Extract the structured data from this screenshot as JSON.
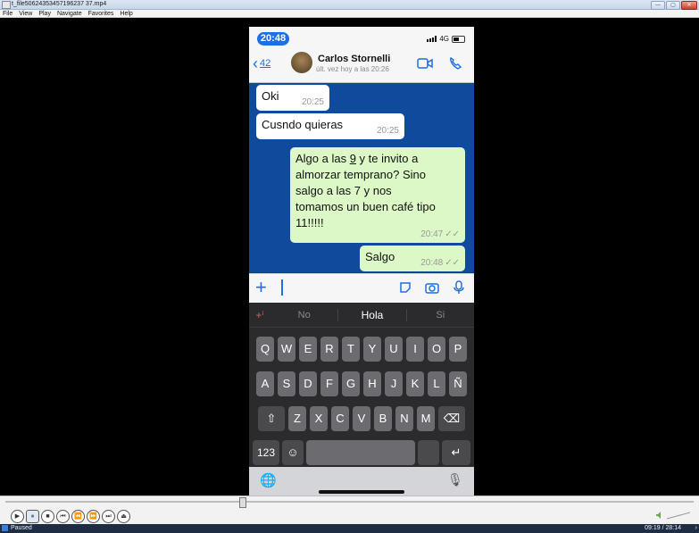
{
  "window": {
    "title": "t_file50624353457196237 37.mp4",
    "controls": [
      "—",
      "▢",
      "✕"
    ]
  },
  "menu": [
    "File",
    "View",
    "Play",
    "Navigate",
    "Favorites",
    "Help"
  ],
  "phone": {
    "status_time": "20:48",
    "network": "4G",
    "chat": {
      "back_count": "42",
      "contact_name": "Carlos Stornelli",
      "last_seen": "últ. vez hoy a las 20:26",
      "messages": [
        {
          "dir": "in",
          "text": "Oki",
          "time": "20:25"
        },
        {
          "dir": "in",
          "text": "Cusndo quieras",
          "time": "20:25"
        },
        {
          "dir": "out",
          "line1_pre": "Algo a las ",
          "line1_link": "9",
          "line1_post": " y te invito a",
          "line2": "almorzar temprano? Sino",
          "line3": "salgo a las 7 y nos",
          "line4": "tomamos un buen café tipo",
          "line5": "11!!!!!",
          "time": "20:47"
        },
        {
          "dir": "out",
          "text": "Salgo",
          "time": "20:48"
        }
      ]
    },
    "keyboard": {
      "suggestions": [
        "No",
        "Hola",
        "Si"
      ],
      "row1": [
        "Q",
        "W",
        "E",
        "R",
        "T",
        "Y",
        "U",
        "I",
        "O",
        "P"
      ],
      "row2": [
        "A",
        "S",
        "D",
        "F",
        "G",
        "H",
        "J",
        "K",
        "L",
        "Ñ"
      ],
      "row3": [
        "Z",
        "X",
        "C",
        "V",
        "B",
        "N",
        "M"
      ],
      "numbers_key": "123",
      "shift_glyph": "⇧",
      "delete_glyph": "⌫",
      "return_glyph": "↵",
      "emoji_glyph": "☺",
      "globe_glyph": "🌐",
      "mic_glyph": "🎙"
    }
  },
  "player": {
    "status": "Paused",
    "timecode": "09:19 / 28:14",
    "buttons": [
      "▶",
      "⏸",
      "■",
      "⏮",
      "⏪",
      "⏩",
      "⏭",
      "⏏"
    ]
  },
  "colors": {
    "accent": "#1e6fe3",
    "chat_bg": "#104a9d",
    "out_bubble": "#dcf8c6"
  }
}
